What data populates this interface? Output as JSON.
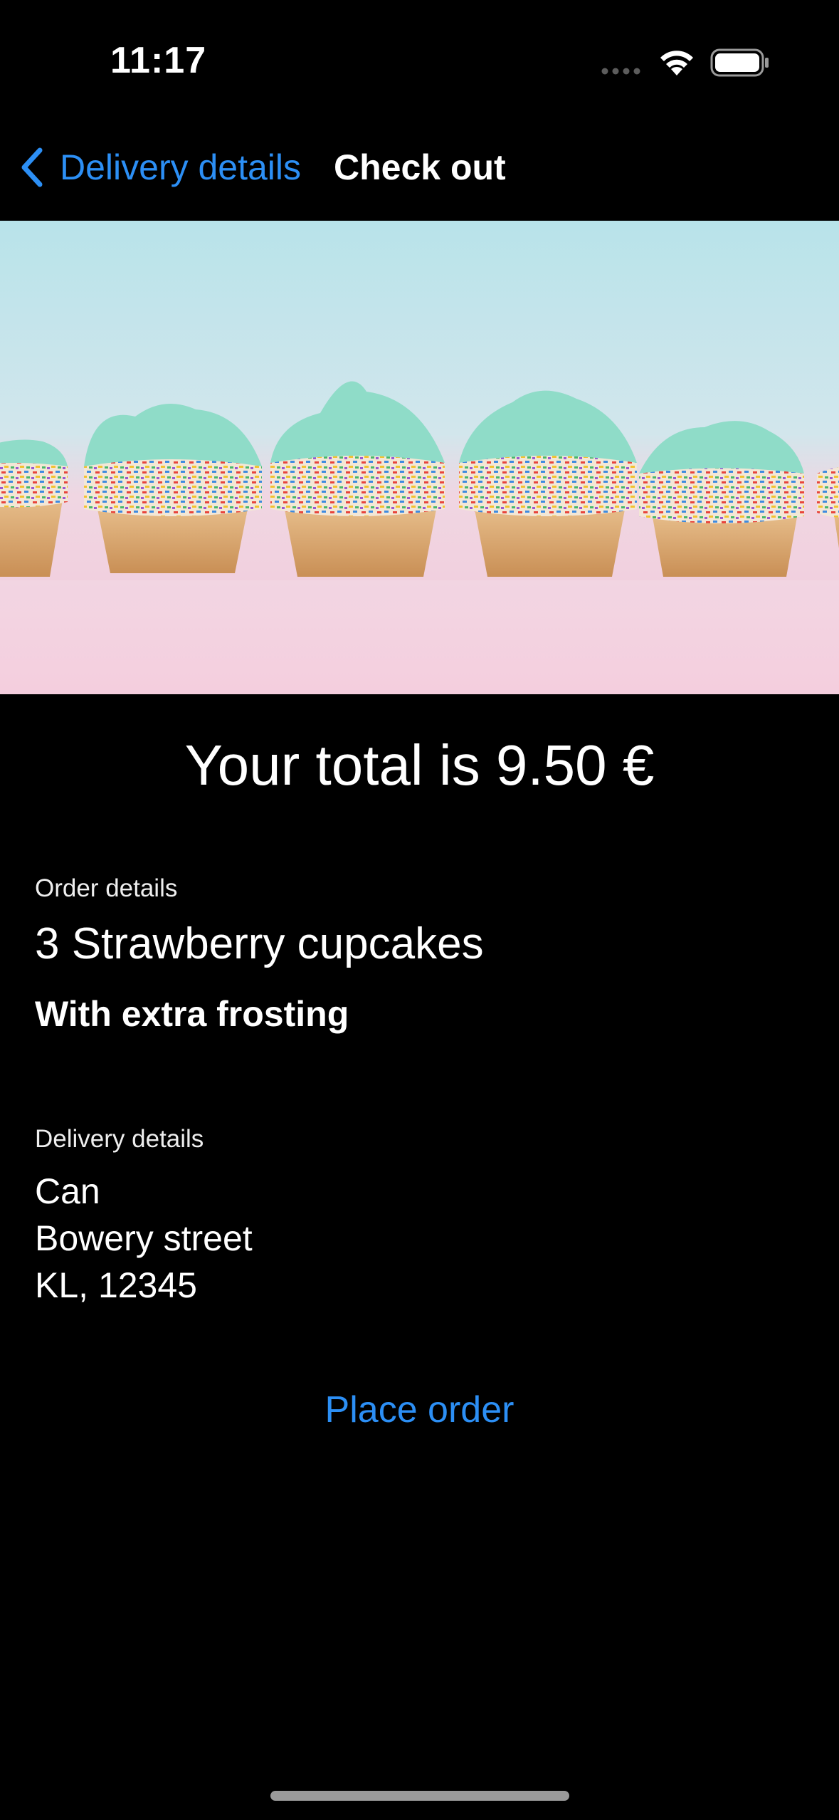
{
  "status_bar": {
    "time": "11:17"
  },
  "nav": {
    "back_label": "Delivery details",
    "title": "Check out"
  },
  "checkout": {
    "total_text": "Your total is 9.50 €",
    "order_details_label": "Order details",
    "order_item": "3 Strawberry cupcakes",
    "order_extra": "With extra frosting",
    "delivery_details_label": "Delivery details",
    "address_name": "Can",
    "address_street": "Bowery street",
    "address_city": "KL, 12345",
    "place_order_label": "Place order"
  },
  "colors": {
    "accent": "#2c8ff5",
    "background": "#000000",
    "frosting": "#8fdcc8",
    "banner_background": "#bfe4ea"
  },
  "icons": {
    "back": "chevron-left-icon",
    "wifi": "wifi-icon",
    "battery": "battery-icon",
    "signal": "cellular-signal-icon"
  }
}
